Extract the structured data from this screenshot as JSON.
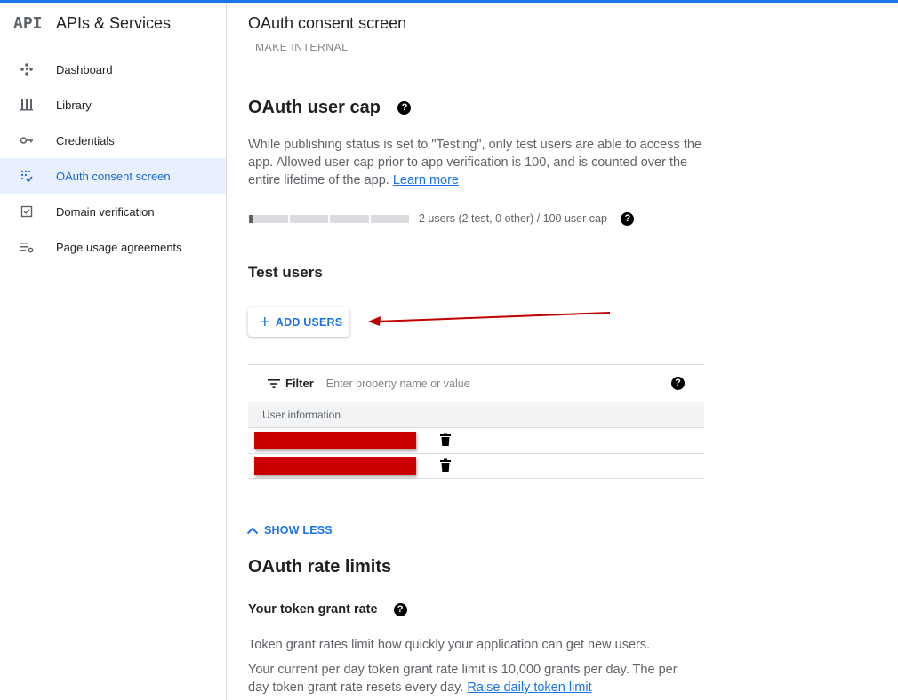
{
  "sidebar": {
    "logo": "API",
    "title": "APIs & Services",
    "items": [
      {
        "label": "Dashboard",
        "icon": "dashboard-icon"
      },
      {
        "label": "Library",
        "icon": "library-icon"
      },
      {
        "label": "Credentials",
        "icon": "key-icon"
      },
      {
        "label": "OAuth consent screen",
        "icon": "consent-icon",
        "active": true
      },
      {
        "label": "Domain verification",
        "icon": "checkbox-icon"
      },
      {
        "label": "Page usage agreements",
        "icon": "settings-list-icon"
      }
    ]
  },
  "header": {
    "title": "OAuth consent screen"
  },
  "main": {
    "cut_button": "MAKE INTERNAL",
    "user_cap": {
      "title": "OAuth user cap",
      "help": "?",
      "description": "While publishing status is set to \"Testing\", only test users are able to access the app. Allowed user cap prior to app verification is 100, and is counted over the entire lifetime of the app.",
      "learn_more": "Learn more",
      "usage_text": "2 users (2 test, 0 other) / 100 user cap",
      "usage_fraction": 0.02
    },
    "test_users": {
      "title": "Test users",
      "add_button": "ADD USERS",
      "filter_label": "Filter",
      "filter_placeholder": "Enter property name or value",
      "column_header": "User information",
      "rows": 2
    },
    "show_less": "SHOW LESS",
    "rate_limits": {
      "title": "OAuth rate limits",
      "subtitle": "Your token grant rate",
      "line1": "Token grant rates limit how quickly your application can get new users.",
      "line2": "Your current per day token grant rate limit is 10,000 grants per day. The per day token grant rate resets every day.",
      "link": "Raise daily token limit"
    }
  },
  "colors": {
    "accent": "#1a73e8",
    "active_bg": "#e8f0fe",
    "redaction": "#cc0000",
    "annotation_arrow": "#c00000"
  }
}
